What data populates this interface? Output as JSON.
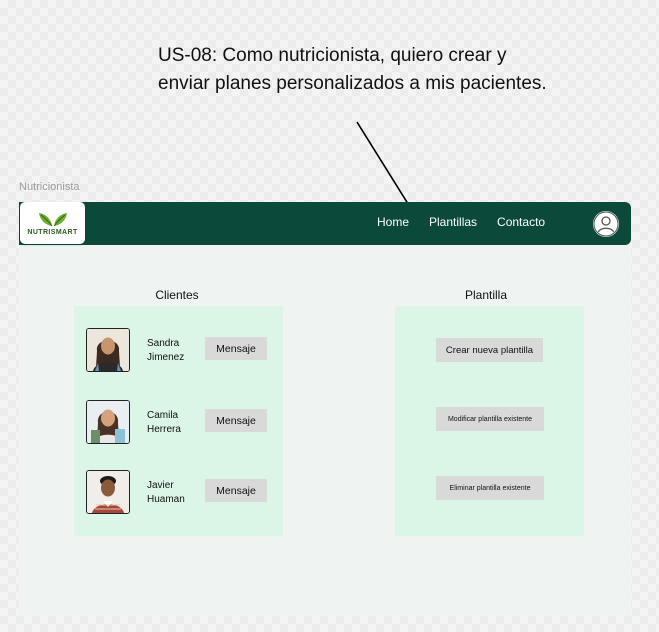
{
  "annotation": {
    "user_story": "US-08: Como nutricionista, quiero crear y enviar planes personalizados a mis pacientes."
  },
  "frame_label": "Nutricionista",
  "navbar": {
    "brand": "NUTRISMART",
    "links": [
      "Home",
      "Plantillas",
      "Contacto"
    ],
    "avatar_icon": "user-avatar-icon"
  },
  "clientes": {
    "title": "Clientes",
    "items": [
      {
        "name": "Sandra Jimenez",
        "button": "Mensaje"
      },
      {
        "name": "Camila Herrera",
        "button": "Mensaje"
      },
      {
        "name": "Javier Huaman",
        "button": "Mensaje"
      }
    ]
  },
  "plantilla": {
    "title": "Plantilla",
    "buttons": [
      "Crear nueva plantilla",
      "Modificar plantilla existente",
      "Eliminar plantilla existente"
    ]
  },
  "colors": {
    "navbar": "#0b4a3b",
    "panel": "#dbf5e6",
    "button": "#d9d9d9"
  }
}
